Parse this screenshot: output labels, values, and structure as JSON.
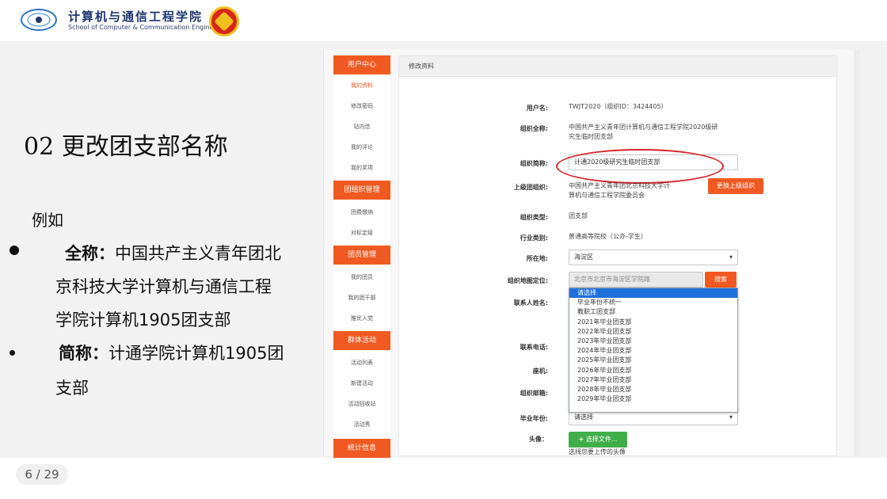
{
  "header": {
    "school_cn": "计算机与通信工程学院",
    "school_en": "School of Computer & Communication Engineering"
  },
  "slide": {
    "title": "02 更改团支部名称",
    "example": "例如",
    "full_label": "全称：",
    "full_line1": "中国共产主义青年团北",
    "full_line2": "京科技大学计算机与通信工程",
    "full_line3": "学院计算机1905团支部",
    "short_label": "简称：",
    "short_line1": "计通学院计算机1905团",
    "short_line2": "支部"
  },
  "nav": [
    {
      "type": "head",
      "label": "用户中心"
    },
    {
      "type": "item",
      "label": "我的资料",
      "active": true
    },
    {
      "type": "item",
      "label": "修改密码"
    },
    {
      "type": "item",
      "label": "站内信"
    },
    {
      "type": "item",
      "label": "我的评论"
    },
    {
      "type": "item",
      "label": "我的奖项"
    },
    {
      "type": "head",
      "label": "团组织管理"
    },
    {
      "type": "item",
      "label": "团费缴纳"
    },
    {
      "type": "item",
      "label": "对标定级"
    },
    {
      "type": "head",
      "label": "团员管理"
    },
    {
      "type": "item",
      "label": "我的团员"
    },
    {
      "type": "item",
      "label": "我的团干部"
    },
    {
      "type": "item",
      "label": "推优入党"
    },
    {
      "type": "head",
      "label": "群体活动"
    },
    {
      "type": "item",
      "label": "活动列表"
    },
    {
      "type": "item",
      "label": "新建活动"
    },
    {
      "type": "item",
      "label": "活动回收站"
    },
    {
      "type": "item",
      "label": "活动秀"
    },
    {
      "type": "head",
      "label": "统计信息"
    }
  ],
  "panel": {
    "title": "修改资料",
    "username_label": "用户名:",
    "username_value": "TWJT2020（组织ID：3424405）",
    "fullname_label": "组织全称:",
    "fullname_value_1": "中国共产主义青年团计算机与通信工程学院2020级研",
    "fullname_value_2": "究生临时团支部",
    "shortname_label": "组织简称:",
    "shortname_value": "计通2020级研究生临时团支部",
    "parent_label": "上级团组织:",
    "parent_value_1": "中国共产主义青年团北京科技大学计",
    "parent_value_2": "算机与通信工程学院委员会",
    "parent_button": "更换上级组织",
    "type_label": "组织类型:",
    "type_value": "团支部",
    "industry_label": "行业类别:",
    "industry_value": "普通高等院校（公办-学生）",
    "location_label": "所在地:",
    "location_value": "海淀区",
    "map_label": "组织地图定位:",
    "map_value": "北京市北京市海淀区学院路",
    "map_button": "搜索",
    "contact_label": "联系人姓名:",
    "phone_label": "联系电话:",
    "landline_label": "座机:",
    "email_label": "组织邮箱:",
    "grad_label": "毕业年份:",
    "grad_value": "请选择",
    "avatar_label": "头像：",
    "avatar_button": "选择文件...",
    "avatar_hint": "选择您要上传的头像"
  },
  "dropdown_options": [
    "请选择",
    "毕业年份不统一",
    "教职工团支部",
    "2021年毕业团支部",
    "2022年毕业团支部",
    "2023年毕业团支部",
    "2024年毕业团支部",
    "2025年毕业团支部",
    "2026年毕业团支部",
    "2027年毕业团支部",
    "2028年毕业团支部",
    "2029年毕业团支部"
  ],
  "footer": {
    "page_indicator": "6 / 29"
  },
  "colors": {
    "accent_orange": "#f05a22",
    "highlight_red": "#d8252a",
    "select_blue": "#1e6fd9",
    "school_blue": "#1e3470"
  },
  "icons": {
    "caret": "▾",
    "plus": "+"
  }
}
